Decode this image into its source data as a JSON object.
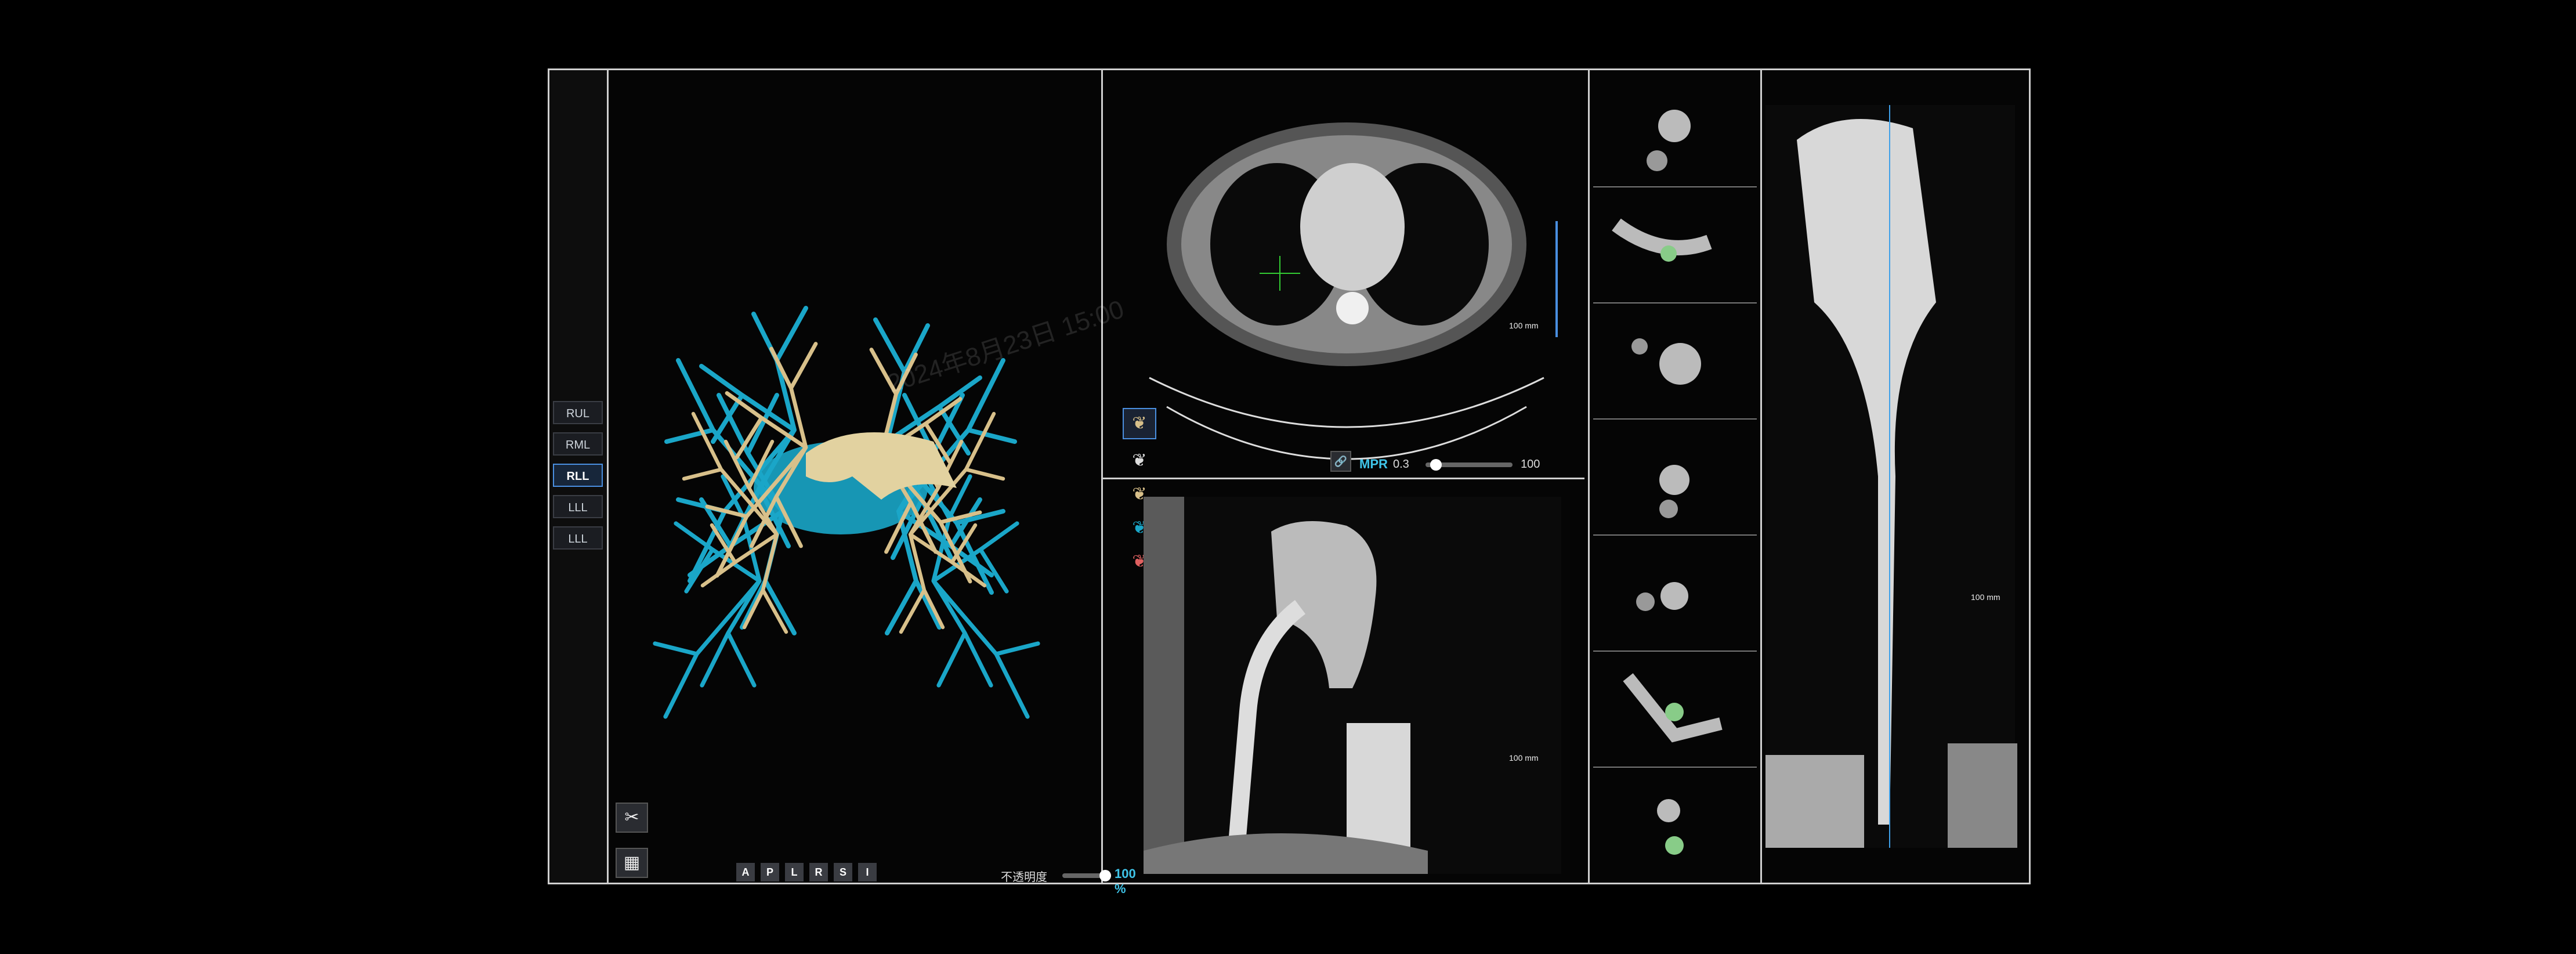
{
  "lobes": [
    "RUL",
    "RML",
    "RLL",
    "LLL",
    "LLL"
  ],
  "active_lobe": "RLL",
  "orientation_buttons": [
    "A",
    "P",
    "L",
    "R",
    "S",
    "I"
  ],
  "opacity_label": "不透明度",
  "opacity_value": "100 %",
  "mpr": {
    "label": "MPR",
    "thickness": "0.3",
    "value": "100"
  },
  "scale_labels": {
    "axial": "100 mm",
    "coronal": "100 mm",
    "cpr": "100 mm"
  },
  "vr_icons": [
    "vr-icon",
    "airway-vessel-icon",
    "vessel-eye-icon",
    "airway-eye-icon",
    "artery-eye-icon"
  ],
  "watermark_date": "2024年8月23日 15:00",
  "colors": {
    "airway": "#1aa6c8",
    "vessel": "#d8c08a",
    "accent": "#3fc4e8",
    "active": "#4a8fe0"
  }
}
